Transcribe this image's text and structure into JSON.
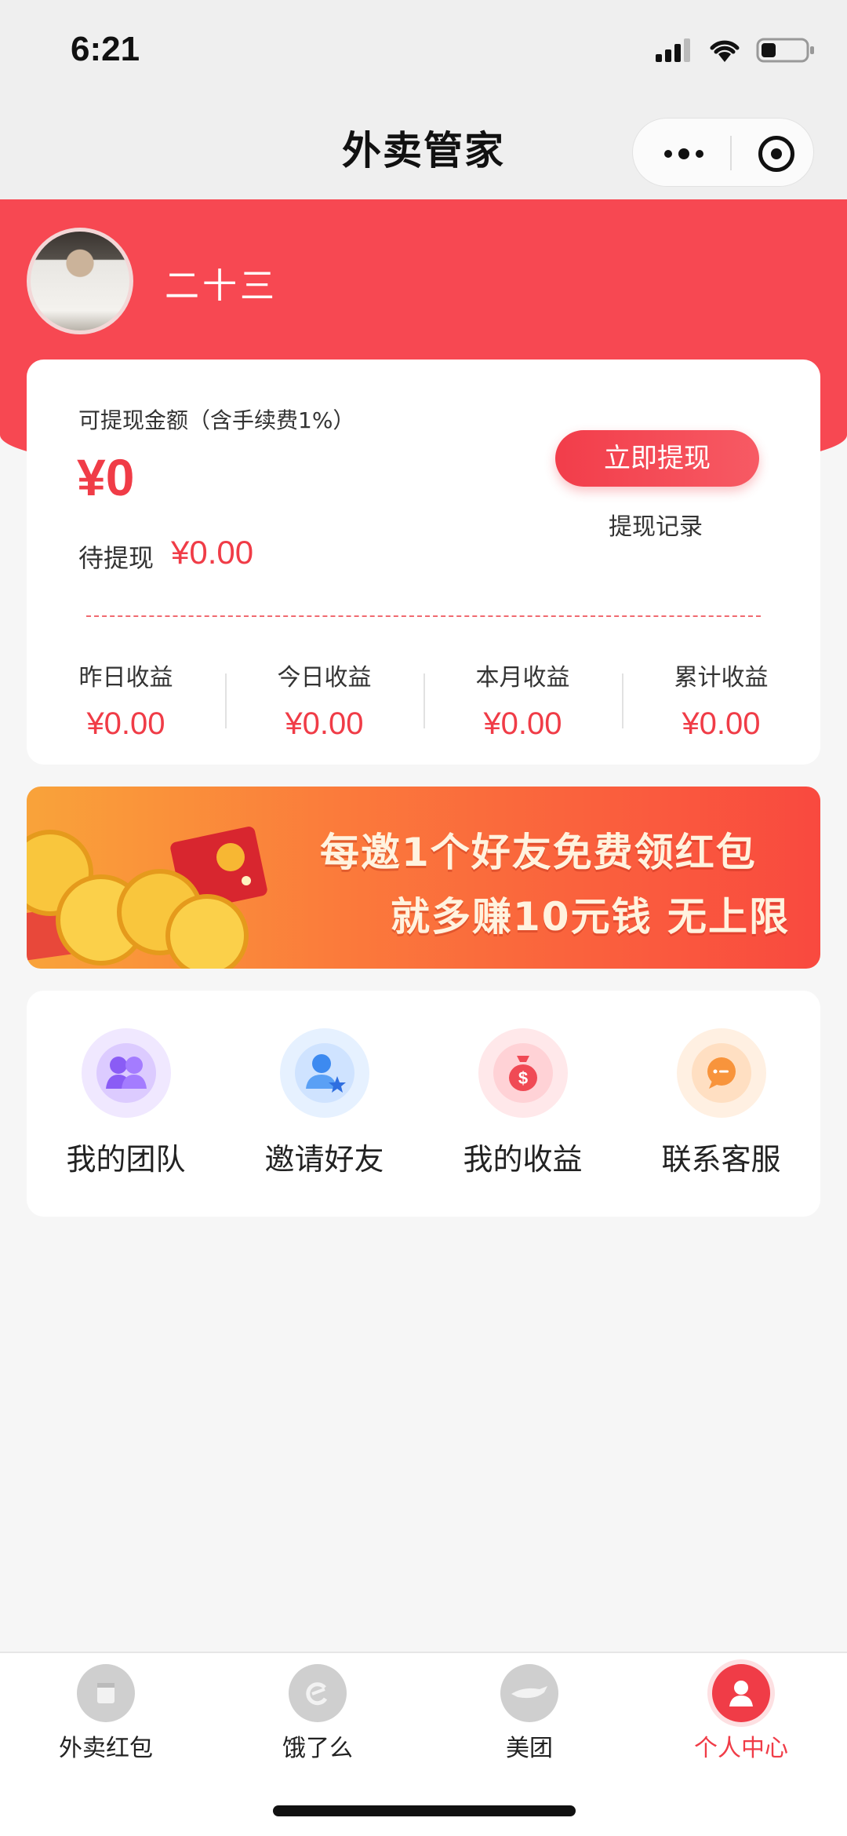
{
  "status": {
    "time": "6:21"
  },
  "nav": {
    "title": "外卖管家"
  },
  "profile": {
    "name": "二十三"
  },
  "balance": {
    "label": "可提现金额（含手续费1%）",
    "amount": "¥0",
    "pending_label": "待提现",
    "pending_value": "¥0.00",
    "withdraw_button": "立即提现",
    "withdraw_record": "提现记录"
  },
  "stats": [
    {
      "label": "昨日收益",
      "value": "¥0.00"
    },
    {
      "label": "今日收益",
      "value": "¥0.00"
    },
    {
      "label": "本月收益",
      "value": "¥0.00"
    },
    {
      "label": "累计收益",
      "value": "¥0.00"
    }
  ],
  "banner": {
    "line1": "每邀1个好友免费领红包",
    "line2": "就多赚10元钱 无上限"
  },
  "menu": [
    {
      "label": "我的团队",
      "icon": "team-icon",
      "color": "#8a5cf5"
    },
    {
      "label": "邀请好友",
      "icon": "invite-friend-icon",
      "color": "#3d8af0"
    },
    {
      "label": "我的收益",
      "icon": "money-bag-icon",
      "color": "#f04a55"
    },
    {
      "label": "联系客服",
      "icon": "chat-icon",
      "color": "#f8943c"
    }
  ],
  "tabs": [
    {
      "label": "外卖红包",
      "icon": "red-envelope-icon",
      "active": false
    },
    {
      "label": "饿了么",
      "icon": "eleme-icon",
      "active": false
    },
    {
      "label": "美团",
      "icon": "meituan-icon",
      "active": false
    },
    {
      "label": "个人中心",
      "icon": "profile-icon",
      "active": true
    }
  ],
  "colors": {
    "accent": "#f74852",
    "price": "#f03c47",
    "active_tab": "#f03c47"
  }
}
